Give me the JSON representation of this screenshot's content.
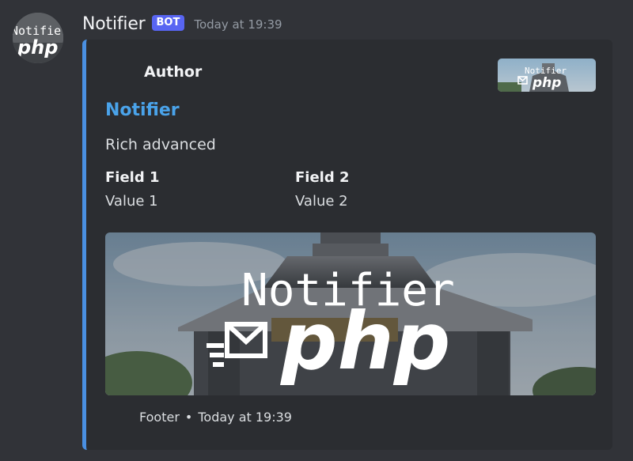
{
  "message": {
    "username": "Notifier",
    "badge": "BOT",
    "timestamp": "Today at 19:39",
    "avatar": {
      "icon": "notifier-php-logo",
      "text_top": "Notifier",
      "text_bottom": "php"
    }
  },
  "embed": {
    "accent_color": "#4a90e2",
    "author": "Author",
    "title": "Notifier",
    "description": "Rich advanced",
    "fields": [
      {
        "name": "Field 1",
        "value": "Value 1"
      },
      {
        "name": "Field 2",
        "value": "Value 2"
      }
    ],
    "thumbnail": {
      "icon": "notifier-php-logo",
      "text_top": "Notifier",
      "text_bottom": "php"
    },
    "image": {
      "icon": "notifier-php-logo",
      "text_top": "Notifier",
      "text_bottom": "php"
    },
    "footer": {
      "text": "Footer",
      "separator": "•",
      "timestamp": "Today at 19:39"
    }
  },
  "colors": {
    "background": "#313338",
    "embed_background": "#2b2d31",
    "title_link": "#4aa3ea",
    "badge": "#5865f2"
  }
}
